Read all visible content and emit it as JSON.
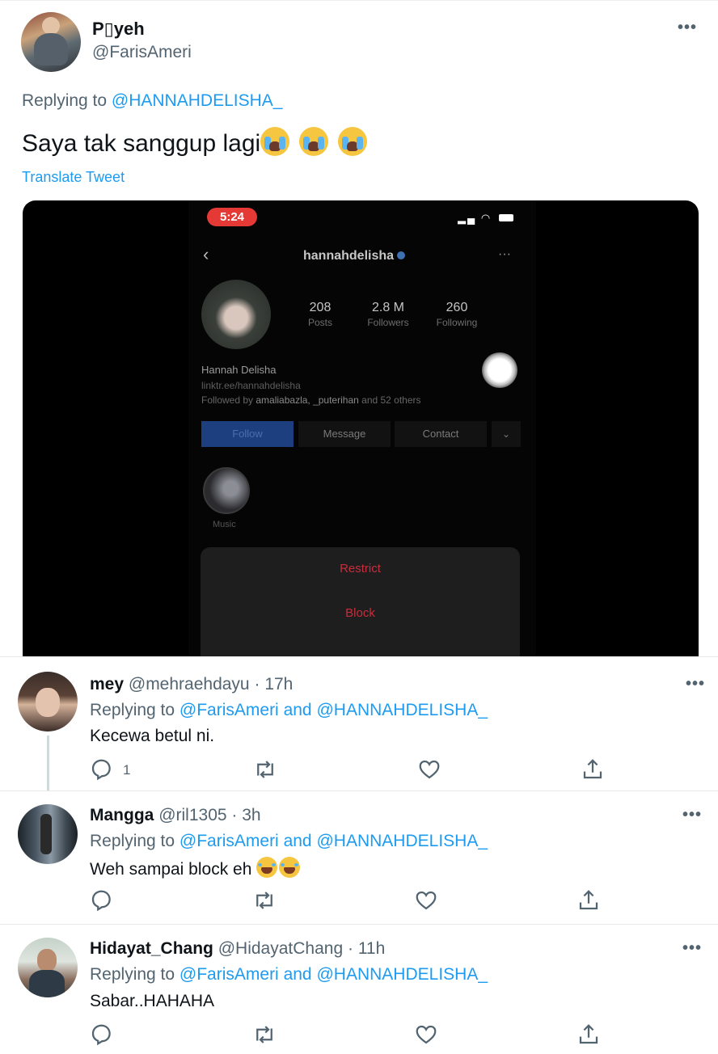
{
  "main_tweet": {
    "display_name": "P▯yeh",
    "handle": "@FarisAmeri",
    "replying_prefix": "Replying to",
    "replying_to": "@HANNAHDELISHA_",
    "text": "Saya tak sanggup lagi",
    "emojis": [
      "loudly-crying-face",
      "loudly-crying-face",
      "loudly-crying-face"
    ],
    "translate_label": "Translate Tweet",
    "more_label": "•••"
  },
  "media": {
    "status_time": "5:24",
    "profile": {
      "username": "hannahdelisha",
      "stats": [
        {
          "value": "208",
          "label": "Posts"
        },
        {
          "value": "2.8 M",
          "label": "Followers"
        },
        {
          "value": "260",
          "label": "Following"
        }
      ],
      "name": "Hannah Delisha",
      "link": "linktr.ee/hannahdelisha",
      "followed_by_prefix": "Followed by",
      "followed_by_names": "amaliabazla, _puterihan",
      "followed_by_suffix": "and 52 others",
      "buttons": {
        "follow": "Follow",
        "message": "Message",
        "contact": "Contact"
      },
      "highlight_label": "Music"
    },
    "sheet": {
      "restrict": "Restrict",
      "block": "Block"
    }
  },
  "replies": [
    {
      "name": "mey",
      "handle": "@mehraehdayu",
      "time": "17h",
      "replying_prefix": "Replying to",
      "replying_to_1": "@FarisAmeri",
      "and": "and",
      "replying_to_2": "@HANNAHDELISHA_",
      "text": "Kecewa betul ni.",
      "reply_count": "1"
    },
    {
      "name": "Mangga",
      "handle": "@ril1305",
      "time": "3h",
      "replying_prefix": "Replying to",
      "replying_to_1": "@FarisAmeri",
      "and": "and",
      "replying_to_2": "@HANNAHDELISHA_",
      "text": "Weh sampai block eh",
      "emojis": [
        "face-with-tears-of-joy",
        "face-with-tears-of-joy"
      ]
    },
    {
      "name": "Hidayat_Chang",
      "handle": "@HidayatChang",
      "time": "11h",
      "replying_prefix": "Replying to",
      "replying_to_1": "@FarisAmeri",
      "and": "and",
      "replying_to_2": "@HANNAHDELISHA_",
      "text": "Sabar..HAHAHA"
    }
  ],
  "separator": "·",
  "colors": {
    "link": "#1d9bf0",
    "secondary_text": "#536471",
    "text": "#0f1419",
    "block_red": "#c62e3d"
  }
}
